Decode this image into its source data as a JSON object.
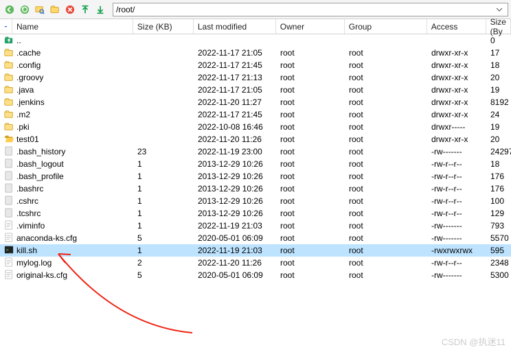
{
  "path": "/root/",
  "columns": {
    "name": "Name",
    "size": "Size (KB)",
    "modified": "Last modified",
    "owner": "Owner",
    "group": "Group",
    "access": "Access",
    "sizeb": "Size (By"
  },
  "selected_index": 17,
  "watermark": "CSDN @执迷11",
  "files": [
    {
      "name": "..",
      "icon": "up",
      "size": "",
      "modified": "",
      "owner": "",
      "group": "",
      "access": "",
      "sizeb": "0"
    },
    {
      "name": ".cache",
      "icon": "folder",
      "size": "",
      "modified": "2022-11-17 21:05",
      "owner": "root",
      "group": "root",
      "access": "drwxr-xr-x",
      "sizeb": "17"
    },
    {
      "name": ".config",
      "icon": "folder",
      "size": "",
      "modified": "2022-11-17 21:45",
      "owner": "root",
      "group": "root",
      "access": "drwxr-xr-x",
      "sizeb": "18"
    },
    {
      "name": ".groovy",
      "icon": "folder",
      "size": "",
      "modified": "2022-11-17 21:13",
      "owner": "root",
      "group": "root",
      "access": "drwxr-xr-x",
      "sizeb": "20"
    },
    {
      "name": ".java",
      "icon": "folder",
      "size": "",
      "modified": "2022-11-17 21:05",
      "owner": "root",
      "group": "root",
      "access": "drwxr-xr-x",
      "sizeb": "19"
    },
    {
      "name": ".jenkins",
      "icon": "folder",
      "size": "",
      "modified": "2022-11-20 11:27",
      "owner": "root",
      "group": "root",
      "access": "drwxr-xr-x",
      "sizeb": "8192"
    },
    {
      "name": ".m2",
      "icon": "folder",
      "size": "",
      "modified": "2022-11-17 21:45",
      "owner": "root",
      "group": "root",
      "access": "drwxr-xr-x",
      "sizeb": "24"
    },
    {
      "name": ".pki",
      "icon": "folder",
      "size": "",
      "modified": "2022-10-08 16:46",
      "owner": "root",
      "group": "root",
      "access": "drwxr-----",
      "sizeb": "19"
    },
    {
      "name": "test01",
      "icon": "folder-open",
      "size": "",
      "modified": "2022-11-20 11:26",
      "owner": "root",
      "group": "root",
      "access": "drwxr-xr-x",
      "sizeb": "20"
    },
    {
      "name": ".bash_history",
      "icon": "file",
      "size": "23",
      "modified": "2022-11-19 23:00",
      "owner": "root",
      "group": "root",
      "access": "-rw-------",
      "sizeb": "24297"
    },
    {
      "name": ".bash_logout",
      "icon": "file",
      "size": "1",
      "modified": "2013-12-29 10:26",
      "owner": "root",
      "group": "root",
      "access": "-rw-r--r--",
      "sizeb": "18"
    },
    {
      "name": ".bash_profile",
      "icon": "file",
      "size": "1",
      "modified": "2013-12-29 10:26",
      "owner": "root",
      "group": "root",
      "access": "-rw-r--r--",
      "sizeb": "176"
    },
    {
      "name": ".bashrc",
      "icon": "file",
      "size": "1",
      "modified": "2013-12-29 10:26",
      "owner": "root",
      "group": "root",
      "access": "-rw-r--r--",
      "sizeb": "176"
    },
    {
      "name": ".cshrc",
      "icon": "file",
      "size": "1",
      "modified": "2013-12-29 10:26",
      "owner": "root",
      "group": "root",
      "access": "-rw-r--r--",
      "sizeb": "100"
    },
    {
      "name": ".tcshrc",
      "icon": "file",
      "size": "1",
      "modified": "2013-12-29 10:26",
      "owner": "root",
      "group": "root",
      "access": "-rw-r--r--",
      "sizeb": "129"
    },
    {
      "name": ".viminfo",
      "icon": "txt",
      "size": "1",
      "modified": "2022-11-19 21:03",
      "owner": "root",
      "group": "root",
      "access": "-rw-------",
      "sizeb": "793"
    },
    {
      "name": "anaconda-ks.cfg",
      "icon": "txt",
      "size": "5",
      "modified": "2020-05-01 06:09",
      "owner": "root",
      "group": "root",
      "access": "-rw-------",
      "sizeb": "5570"
    },
    {
      "name": "kill.sh",
      "icon": "sh",
      "size": "1",
      "modified": "2022-11-19 21:03",
      "owner": "root",
      "group": "root",
      "access": "-rwxrwxrwx",
      "sizeb": "595"
    },
    {
      "name": "mylog.log",
      "icon": "txt",
      "size": "2",
      "modified": "2022-11-20 11:26",
      "owner": "root",
      "group": "root",
      "access": "-rw-r--r--",
      "sizeb": "2348"
    },
    {
      "name": "original-ks.cfg",
      "icon": "txt",
      "size": "5",
      "modified": "2020-05-01 06:09",
      "owner": "root",
      "group": "root",
      "access": "-rw-------",
      "sizeb": "5300"
    }
  ]
}
